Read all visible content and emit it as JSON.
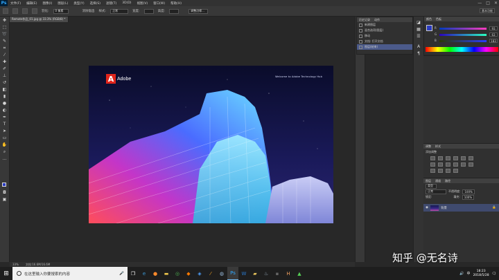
{
  "app": {
    "logo": "Ps"
  },
  "menu": [
    "文件(F)",
    "编辑(E)",
    "图像(I)",
    "图层(L)",
    "类型(Y)",
    "选择(S)",
    "滤镜(T)",
    "3D(D)",
    "视图(V)",
    "窗口(W)",
    "帮助(H)"
  ],
  "window_controls": {
    "minimize": "—",
    "maximize": "□",
    "close": "✕"
  },
  "options": {
    "feather_label": "羽化:",
    "feather_value": "0 像素",
    "antialias": "消除锯齿",
    "style_label": "样式:",
    "style_value": "正常",
    "width_label": "宽度:",
    "height_label": "高度:",
    "refine": "调整边缘...",
    "workspace": "基本功能"
  },
  "doc_tab": "Remote作品_01.jpg @ 33.3% (RGB/8) *",
  "status": {
    "zoom": "33%",
    "doc": "文档:16.6M/16.6M"
  },
  "image": {
    "brand": "Adobe",
    "top_text": "Welcome to Adobe Technology Hub"
  },
  "history": {
    "tabs": [
      "历史记录",
      "动作"
    ],
    "items": [
      "新建图层",
      "混合选项(图层)",
      "移动",
      "文档: 打开文档",
      "图层(结束)"
    ],
    "selected": 4
  },
  "color_panel": {
    "tabs": [
      "颜色",
      "色板"
    ],
    "sliders": [
      {
        "label": "R",
        "value": "93"
      },
      {
        "label": "G",
        "value": "63"
      },
      {
        "label": "B",
        "value": "183"
      }
    ]
  },
  "adjustments": {
    "tabs": [
      "调整",
      "样式"
    ],
    "title": "添加调整"
  },
  "layers": {
    "tabs": [
      "图层",
      "通道",
      "路径"
    ],
    "filter": "类型",
    "blend": "正常",
    "opacity_label": "不透明度:",
    "opacity": "100%",
    "lock_label": "锁定:",
    "fill_label": "填充:",
    "fill": "100%",
    "layer_name": "背景"
  },
  "taskbar": {
    "search_placeholder": "在这里输入你要搜索的内容",
    "time": "18:23",
    "date": "2018/5/28",
    "lang": "中"
  },
  "watermark": "知乎 @无名诗",
  "colors": {
    "accent": "#31a8ff",
    "selection": "#4b5a8a",
    "fg": "#2a3bbf"
  }
}
